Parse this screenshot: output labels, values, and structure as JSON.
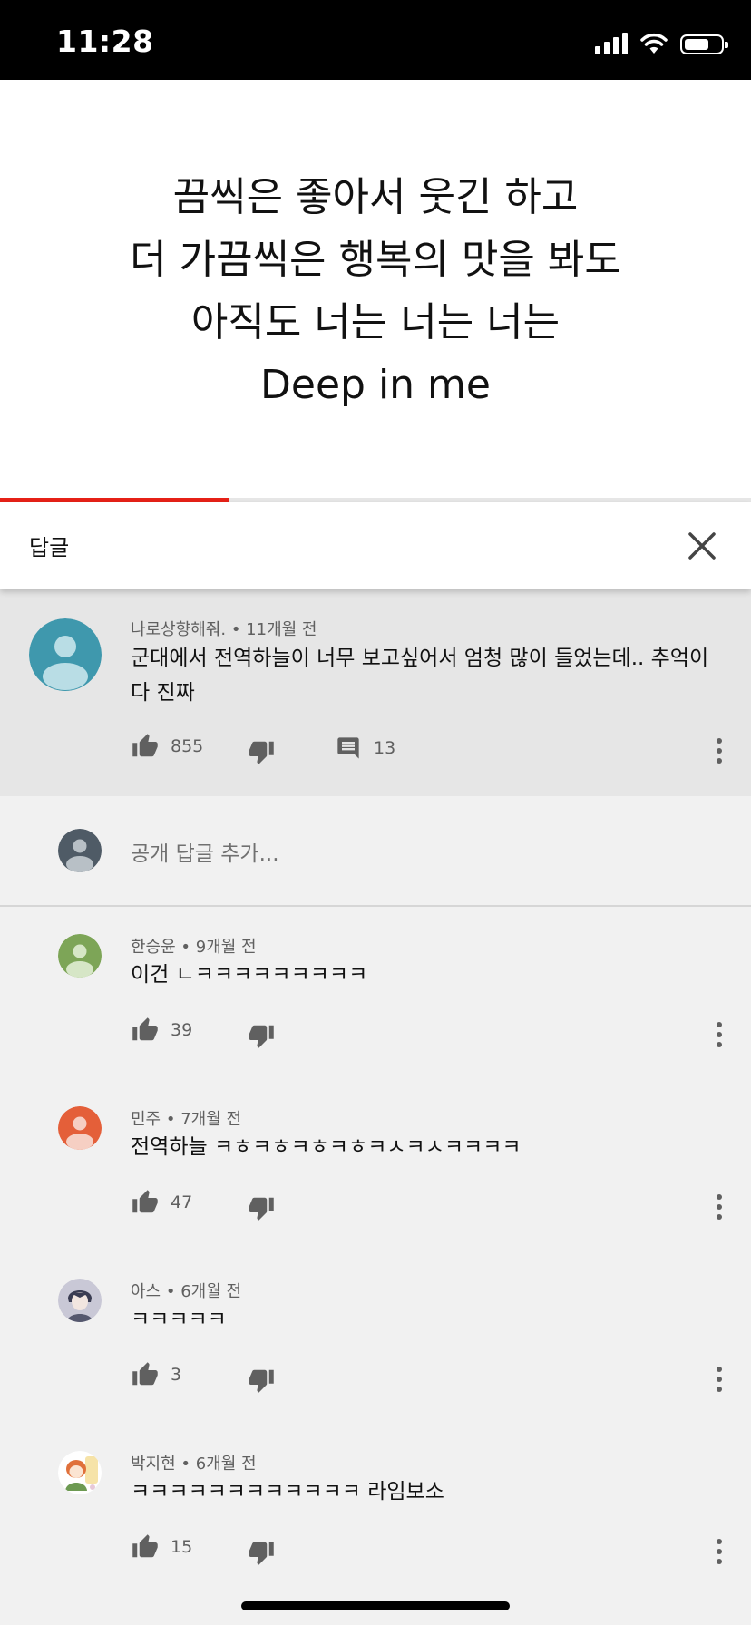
{
  "status_bar": {
    "time": "11:28"
  },
  "lyrics": {
    "lines": [
      "끔씩은 좋아서 웃긴 하고",
      "더 가끔씩은 행복의 맛을 봐도",
      "아직도 너는 너는 너는",
      "Deep in me"
    ],
    "progress": 0.305
  },
  "header": {
    "title": "답글"
  },
  "parent_comment": {
    "author": "나로상향해줘.",
    "time": "11개월 전",
    "text": "군대에서 전역하늘이 너무 보고싶어서 엄청 많이 들었는데.. 추억이다 진짜",
    "likes": "855",
    "replies": "13"
  },
  "add_reply": {
    "placeholder": "공개 답글 추가..."
  },
  "replies": [
    {
      "author": "한승윤",
      "time": "9개월 전",
      "text": "이건 ㄴㅋㅋㅋㅋㅋㅋㅋㅋㅋ",
      "likes": "39",
      "avatar_color": "#7da557"
    },
    {
      "author": "민주",
      "time": "7개월 전",
      "text": "전역하늘 ㅋㅎㅋㅎㅋㅎㅋㅎㅋㅅㅋㅅㅋㅋㅋㅋ",
      "likes": "47",
      "avatar_color": "#e45f39"
    },
    {
      "author": "아스",
      "time": "6개월 전",
      "text": "ㅋㅋㅋㅋㅋ",
      "likes": "3",
      "avatar_color": "#c9c8d6"
    },
    {
      "author": "박지현",
      "time": "6개월 전",
      "text": "ㅋㅋㅋㅋㅋㅋㅋㅋㅋㅋㅋㅋ 라임보소",
      "likes": "15",
      "avatar_color": "#f6e3a8"
    }
  ],
  "icons": {
    "like": "thumb-up-icon",
    "dislike": "thumb-down-icon",
    "reply": "comment-icon",
    "more": "more-vert-icon",
    "close": "close-icon"
  }
}
